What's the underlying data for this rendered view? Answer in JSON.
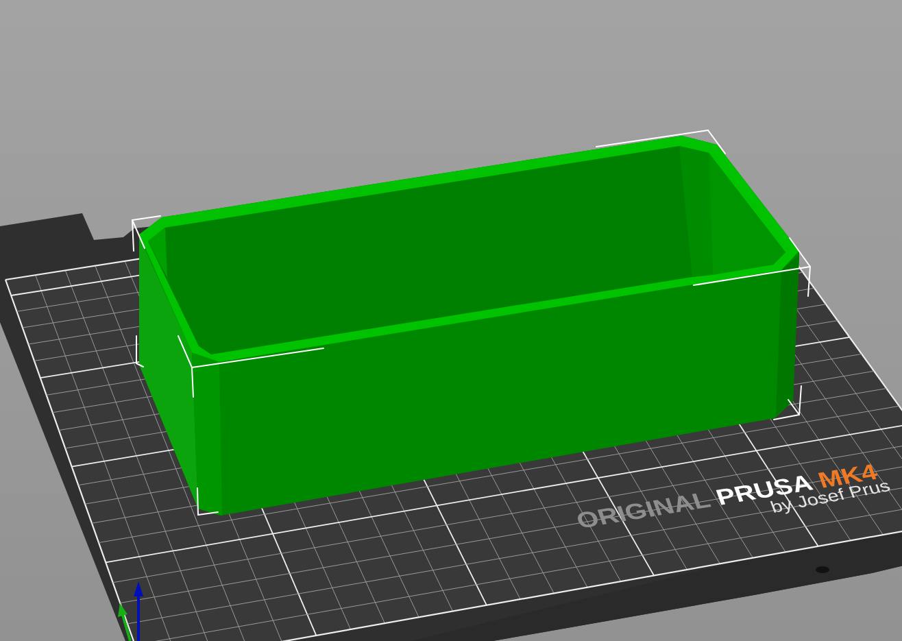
{
  "viewport": {
    "objects": [
      {
        "selected": true
      }
    ],
    "bed": {
      "logo": {
        "title": [
          {
            "text": "ORIGINAL",
            "color": "#8e8e8e"
          },
          {
            "text": "PRUSA",
            "color": "#ffffff"
          },
          {
            "text": "MK4",
            "color": "#ef7a26"
          }
        ],
        "byline": "by Josef Prus"
      }
    }
  }
}
